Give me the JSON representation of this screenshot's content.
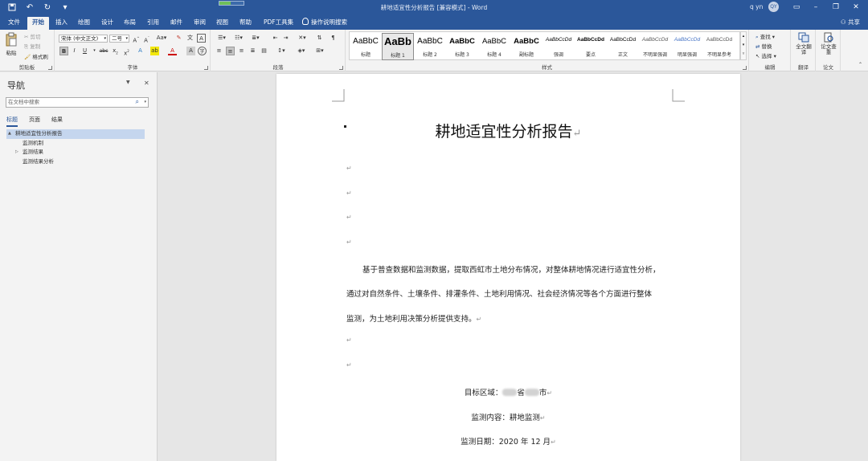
{
  "titlebar": {
    "doc_title": "耕地适宜性分析报告 [兼容模式]  -  Word",
    "user": "q yn",
    "avatar": "QY",
    "progress": 0.45,
    "quick_access": [
      "save-icon",
      "undo-icon",
      "redo-icon",
      "customize-icon"
    ],
    "window_buttons": [
      "ribbon-display-icon",
      "minimize-icon",
      "restore-icon",
      "close-icon"
    ]
  },
  "tabs": [
    {
      "label": "文件",
      "active": false
    },
    {
      "label": "开始",
      "active": true
    },
    {
      "label": "插入",
      "active": false
    },
    {
      "label": "绘图",
      "active": false
    },
    {
      "label": "设计",
      "active": false
    },
    {
      "label": "布局",
      "active": false
    },
    {
      "label": "引用",
      "active": false
    },
    {
      "label": "邮件",
      "active": false
    },
    {
      "label": "审阅",
      "active": false
    },
    {
      "label": "视图",
      "active": false
    },
    {
      "label": "帮助",
      "active": false
    },
    {
      "label": "PDF工具集",
      "active": false
    },
    {
      "label": "操作说明搜索",
      "active": false
    }
  ],
  "share_label": "共享",
  "ribbon": {
    "clipboard": {
      "label": "剪贴板",
      "paste": "粘贴",
      "cut": "剪切",
      "copy": "复制",
      "format_painter": "格式刷"
    },
    "font": {
      "label": "字体",
      "font_name": "宋体 (中文正文)",
      "font_size": "二号"
    },
    "paragraph": {
      "label": "段落"
    },
    "styles": {
      "label": "样式",
      "items": [
        {
          "sample": "AaBbC",
          "name": "标题"
        },
        {
          "sample": "AaBb",
          "name": "标题 1"
        },
        {
          "sample": "AaBbC",
          "name": "标题 2"
        },
        {
          "sample": "AaBbC",
          "name": "标题 3"
        },
        {
          "sample": "AaBbC",
          "name": "标题 4"
        },
        {
          "sample": "AaBbC",
          "name": "副标题"
        },
        {
          "sample": "AaBbCcDd",
          "name": "强调"
        },
        {
          "sample": "AaBbCcDd",
          "name": "要点"
        },
        {
          "sample": "AaBbCcDd",
          "name": "正文"
        },
        {
          "sample": "AaBbCcDd",
          "name": "不明显强调"
        },
        {
          "sample": "AaBbCcDd",
          "name": "明显强调"
        },
        {
          "sample": "AaBbCcDd",
          "name": "不明显参考"
        }
      ]
    },
    "editing": {
      "label": "编辑",
      "find": "查找",
      "replace": "替换",
      "select": "选择"
    },
    "translate": {
      "label": "翻译",
      "button": "全文翻译"
    },
    "paper": {
      "label": "论文",
      "button": "论文查重"
    }
  },
  "nav": {
    "title": "导航",
    "search_placeholder": "在文档中搜索",
    "tabs": [
      "标题",
      "页面",
      "结果"
    ],
    "tree": [
      {
        "label": "耕地适宜性分析报告",
        "level": 0,
        "selected": true,
        "twisty": "▲"
      },
      {
        "label": "监测机制",
        "level": 1,
        "selected": false,
        "twisty": ""
      },
      {
        "label": "监测结果",
        "level": 1,
        "selected": false,
        "twisty": "▷"
      },
      {
        "label": "监测结果分析",
        "level": 1,
        "selected": false,
        "twisty": ""
      }
    ]
  },
  "document": {
    "title": "耕地适宜性分析报告",
    "para_lines": [
      "基于普查数据和监测数据，提取西虹市土地分布情况，对整体耕地情况进行适宜性分析，",
      "通过对自然条件、土壤条件、排灌条件、土地利用情况、社会经济情况等各个方面进行整体",
      "监测，为土地利用决策分析提供支持。"
    ],
    "target_label": "目标区域：",
    "target_province": "省",
    "target_city": "市",
    "content": "监测内容：耕地监测",
    "date": "监测日期：2020 年 12 月",
    "para_mark": "↵"
  }
}
